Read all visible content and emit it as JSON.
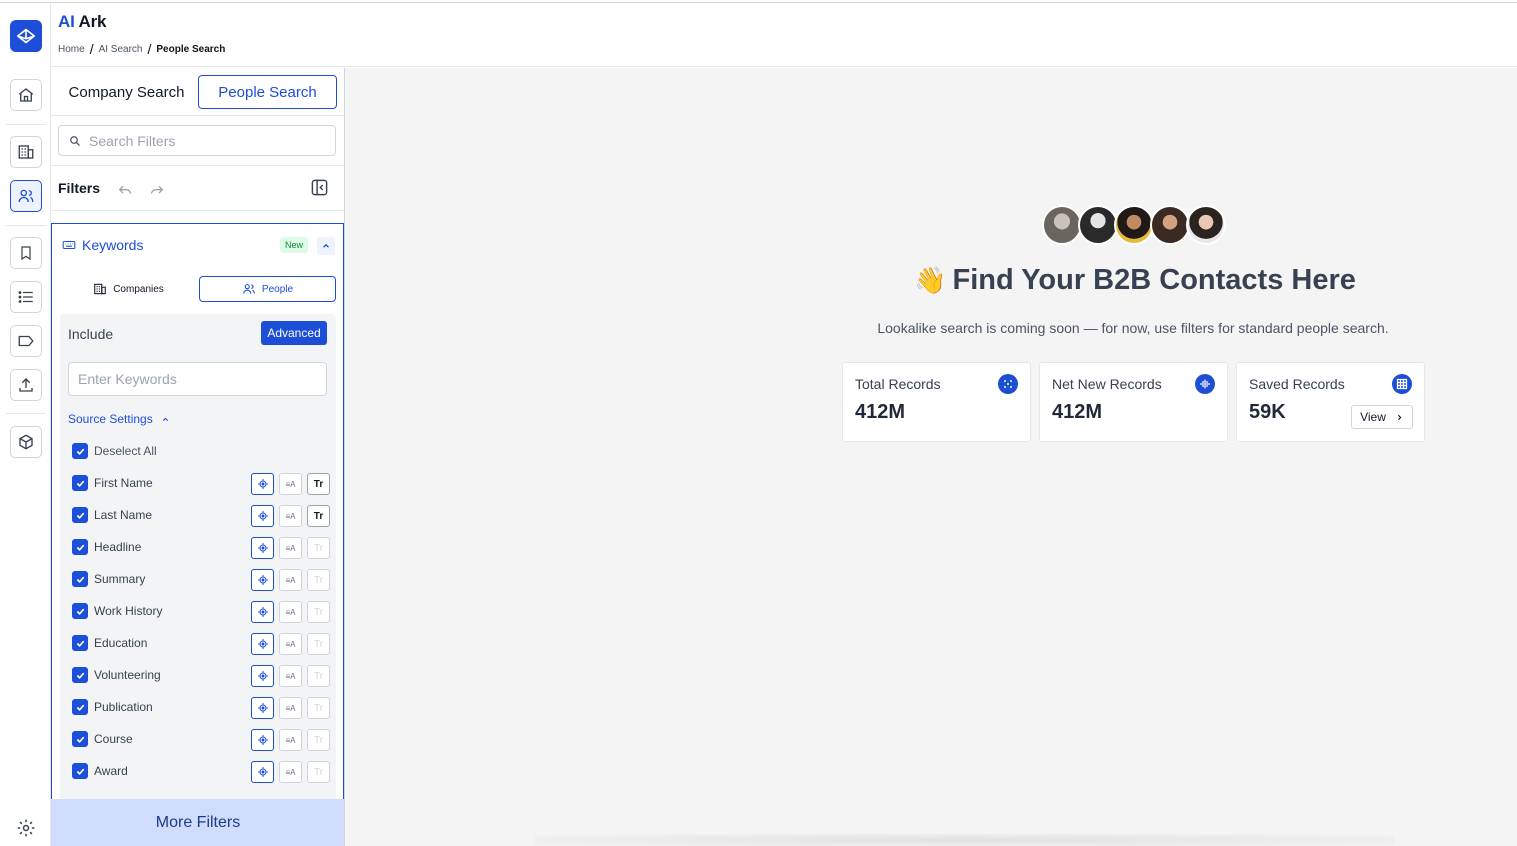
{
  "brand": {
    "ai": "AI",
    "ark": "Ark"
  },
  "breadcrumb": {
    "home": "Home",
    "ai_search": "AI Search",
    "current": "People Search"
  },
  "tabs": {
    "company": "Company Search",
    "people": "People Search"
  },
  "search": {
    "placeholder": "Search Filters"
  },
  "filters": {
    "title": "Filters"
  },
  "keywords": {
    "title": "Keywords",
    "badge": "New",
    "seg_companies": "Companies",
    "seg_people": "People",
    "include": "Include",
    "advanced": "Advanced",
    "input_placeholder": "Enter Keywords",
    "source_settings": "Source Settings",
    "sources": [
      {
        "label": "Deselect All"
      },
      {
        "label": "First Name"
      },
      {
        "label": "Last Name"
      },
      {
        "label": "Headline"
      },
      {
        "label": "Summary"
      },
      {
        "label": "Work History"
      },
      {
        "label": "Education"
      },
      {
        "label": "Volunteering"
      },
      {
        "label": "Publication"
      },
      {
        "label": "Course"
      },
      {
        "label": "Award"
      }
    ],
    "tool_labels": {
      "t2": "≡A",
      "t3": "Tr"
    }
  },
  "more_filters": "More Filters",
  "hero": {
    "emoji": "👋",
    "title": "Find Your B2B Contacts Here",
    "subtitle": "Lookalike search is coming soon — for now, use filters for standard people search."
  },
  "stats": [
    {
      "label": "Total Records",
      "value": "412M"
    },
    {
      "label": "Net New Records",
      "value": "412M"
    },
    {
      "label": "Saved Records",
      "value": "59K",
      "action": "View"
    }
  ],
  "colors": {
    "accent": "#1d4ed8",
    "main_bg": "#f4f4f5",
    "more_filters_bg": "#cfdcfb"
  }
}
